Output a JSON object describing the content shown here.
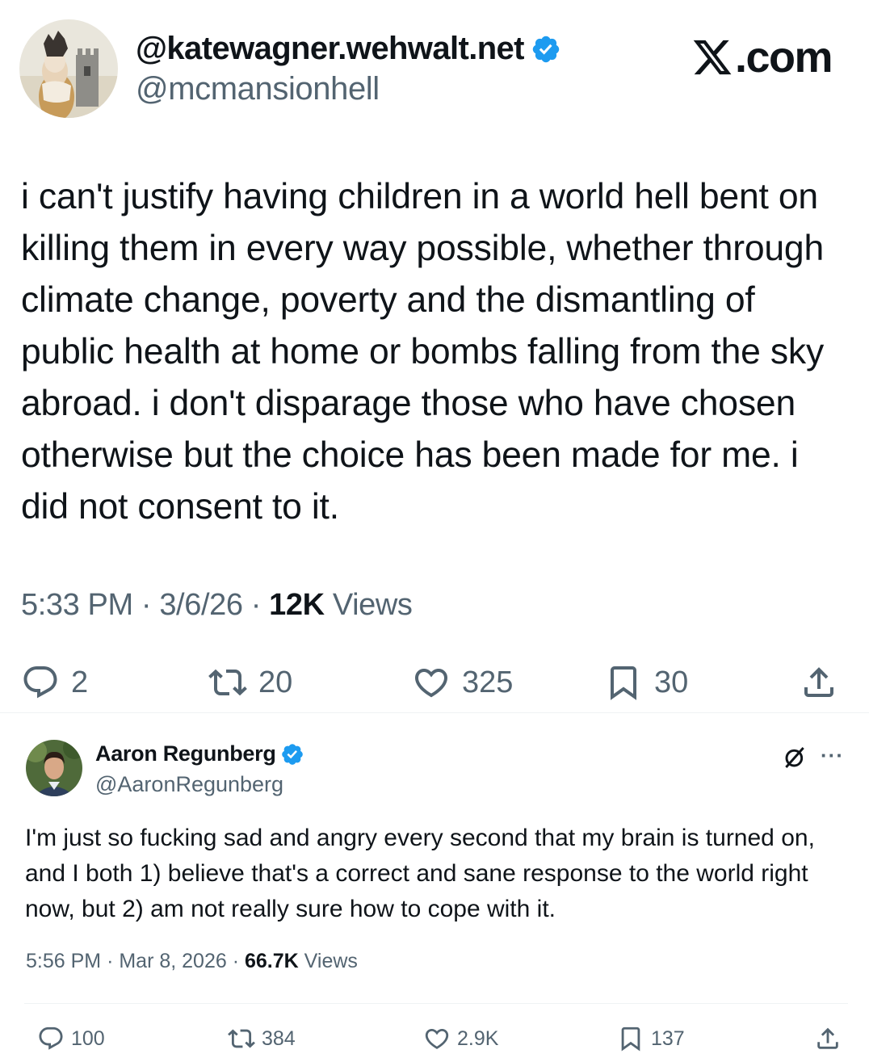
{
  "colors": {
    "text": "#0f1419",
    "secondary": "#536471",
    "verified": "#1d9bf0",
    "separator": "#eff3f4"
  },
  "tweet1": {
    "display_name": "@katewagner.wehwalt.net",
    "handle": "@mcmansionhell",
    "brand": ".com",
    "brand_icon": "x-logo-icon",
    "avatar": "avatar-figurine-castle",
    "text": "i can't justify having children in a world hell bent on killing them in every way possible, whether through climate change, poverty and the dismantling of public health at home or bombs falling from the sky abroad. i don't disparage those who have chosen otherwise but the choice has been made for me. i did not consent to it.",
    "time": "5:33 PM",
    "date": "3/6/26",
    "views_count": "12K",
    "views_label": "Views",
    "replies": "2",
    "reposts": "20",
    "likes": "325",
    "bookmarks": "30"
  },
  "tweet2": {
    "display_name": "Aaron Regunberg",
    "handle": "@AaronRegunberg",
    "avatar": "avatar-man-portrait",
    "more_label": "···",
    "text": "I'm just so fucking sad and angry every second that my brain is turned on, and I both 1) believe that's a correct and sane response to the world right now, but 2) am not really sure how to cope with it.",
    "time": "5:56 PM",
    "date": "Mar 8, 2026",
    "views_count": "66.7K",
    "views_label": "Views",
    "replies": "100",
    "reposts": "384",
    "likes": "2.9K",
    "bookmarks": "137"
  }
}
